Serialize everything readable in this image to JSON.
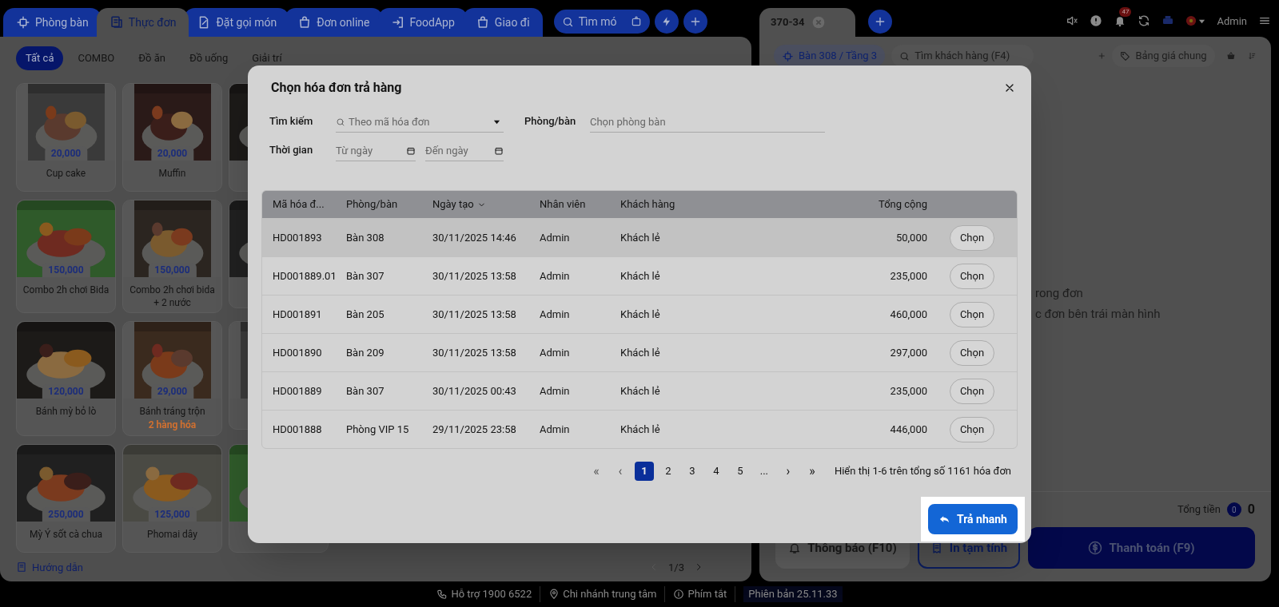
{
  "left_tabs": [
    {
      "label": "Phòng bàn",
      "selected": false
    },
    {
      "label": "Thực đơn",
      "selected": true
    },
    {
      "label": "Đặt gọi món",
      "selected": false
    },
    {
      "label": "Đơn online",
      "selected": false
    },
    {
      "label": "FoodApp",
      "selected": false
    },
    {
      "label": "Giao đi",
      "selected": false
    }
  ],
  "quick_search": {
    "placeholder": "Tìm mó"
  },
  "categories": [
    {
      "label": "Tất cả",
      "selected": true
    },
    {
      "label": "COMBO",
      "selected": false
    },
    {
      "label": "Đồ ăn",
      "selected": false
    },
    {
      "label": "Đồ uống",
      "selected": false
    },
    {
      "label": "Giải trí",
      "selected": false
    }
  ],
  "products": [
    {
      "name": "Cup cake",
      "price": "20,000"
    },
    {
      "name": "Muffin",
      "price": "20,000"
    },
    {
      "name": "Combo 2h chơi Bida",
      "price": "150,000"
    },
    {
      "name": "Combo 2h chơi bida + 2 nước",
      "price": "150,000"
    },
    {
      "name": "Bánh mỳ bỏ lò",
      "price": "120,000"
    },
    {
      "name": "Bánh tráng trộn",
      "price": "29,000",
      "note": "2 hàng hóa"
    },
    {
      "name": "Mỳ Ý sốt cà chua",
      "price": "250,000"
    },
    {
      "name": "Phomai dây",
      "price": "125,000"
    }
  ],
  "left_footer": {
    "guide": "Hướng dẫn",
    "page": "1/3"
  },
  "order_tab": {
    "label": "370-34"
  },
  "header_right": {
    "notification_count": "47",
    "user": "Admin"
  },
  "order_toolbar": {
    "table": "Bàn 308 / Tầng 3",
    "customer_search": {
      "placeholder": "Tìm khách hàng (F4)"
    },
    "price_list": "Bảng giá chung"
  },
  "empty_state": [
    "rong đơn",
    "c đơn bên trái màn hình"
  ],
  "totals": {
    "label": "Tổng tiền",
    "count": "0",
    "amount": "0"
  },
  "actions": [
    {
      "label": "Thông báo (F10)",
      "kind": "secondary"
    },
    {
      "label": "In tạm tính",
      "kind": "outline"
    },
    {
      "label": "Thanh toán (F9)",
      "kind": "primary"
    }
  ],
  "status_bar": [
    "Hỗ trợ 1900 6522",
    "Chi nhánh trung tâm",
    "Phím tắt",
    "Phiên bản 25.11.33"
  ],
  "dialog": {
    "title": "Chọn hóa đơn trả hàng",
    "search": {
      "label": "Tìm kiếm",
      "placeholder": "Theo mã hóa đơn"
    },
    "room": {
      "label": "Phòng/bàn",
      "placeholder": "Chọn phòng bàn"
    },
    "time": {
      "label": "Thời gian",
      "from_placeholder": "Từ ngày",
      "to_placeholder": "Đến ngày"
    },
    "columns": [
      "Mã hóa đ...",
      "Phòng/bàn",
      "Ngày tạo",
      "Nhân viên",
      "Khách hàng",
      "Tổng cộng"
    ],
    "rows": [
      {
        "code": "HD001893",
        "room": "Bàn 308",
        "date": "30/11/2025 14:46",
        "staff": "Admin",
        "customer": "Khách lẻ",
        "total": "50,000",
        "action": "Chọn",
        "selected": true
      },
      {
        "code": "HD001889.01",
        "room": "Bàn 307",
        "date": "30/11/2025 13:58",
        "staff": "Admin",
        "customer": "Khách lẻ",
        "total": "235,000",
        "action": "Chọn",
        "selected": false
      },
      {
        "code": "HD001891",
        "room": "Bàn 205",
        "date": "30/11/2025 13:58",
        "staff": "Admin",
        "customer": "Khách lẻ",
        "total": "460,000",
        "action": "Chọn",
        "selected": false
      },
      {
        "code": "HD001890",
        "room": "Bàn 209",
        "date": "30/11/2025 13:58",
        "staff": "Admin",
        "customer": "Khách lẻ",
        "total": "297,000",
        "action": "Chọn",
        "selected": false
      },
      {
        "code": "HD001889",
        "room": "Bàn 307",
        "date": "30/11/2025 00:43",
        "staff": "Admin",
        "customer": "Khách lẻ",
        "total": "235,000",
        "action": "Chọn",
        "selected": false
      },
      {
        "code": "HD001888",
        "room": "Phòng VIP 15",
        "date": "29/11/2025 23:58",
        "staff": "Admin",
        "customer": "Khách lẻ",
        "total": "446,000",
        "action": "Chọn",
        "selected": false
      }
    ],
    "pagination": {
      "first": "«",
      "prev": "‹",
      "pages": [
        {
          "label": "1",
          "selected": true
        },
        {
          "label": "2",
          "selected": false
        },
        {
          "label": "3",
          "selected": false
        },
        {
          "label": "4",
          "selected": false
        },
        {
          "label": "5",
          "selected": false
        },
        {
          "label": "...",
          "selected": false
        }
      ],
      "next": "›",
      "last": "»",
      "summary": "Hiển thị 1-6 trên tổng số 1161 hóa đơn"
    },
    "quick_return": "Trả nhanh"
  }
}
